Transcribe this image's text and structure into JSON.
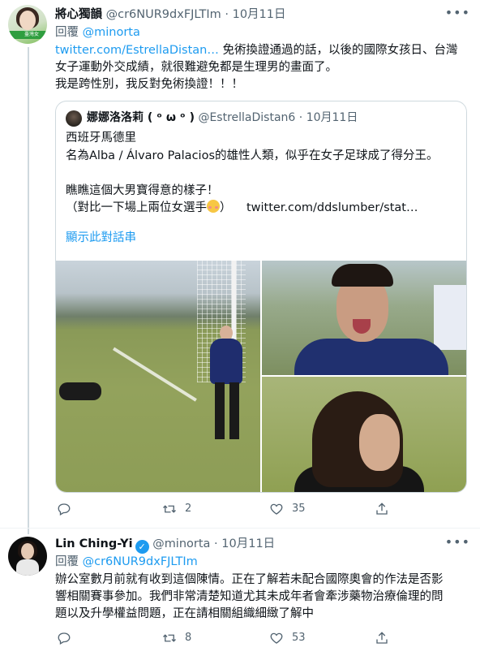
{
  "tweet1": {
    "display_name": "將心獨韻",
    "handle": "@cr6NUR9dxFJLTIm",
    "separator": "·",
    "date": "10月11日",
    "avatar_badge": "臺灣女",
    "reply_prefix": "回覆",
    "reply_mention": "@minorta",
    "body_link": "twitter.com/EstrellaDistan…",
    "body_line1_rest": " 免術換證通過的話，以後的國際女孩日、台灣",
    "body_line2": "女子運動外交成績，就很難避免都是生理男的畫面了。",
    "body_line3": "我是跨性別，我反對免術換證！！！",
    "quote": {
      "display_name": "娜娜洛洛莉 ( ᵒ ω ᵒ )",
      "handle": "@EstrellaDistan6",
      "separator": "·",
      "date": "10月11日",
      "lines": [
        "西班牙馬德里",
        "名為Alba / Álvaro Palacios的雄性人類，似乎在女子足球成了得分王。",
        "",
        "瞧瞧這個大男寶得意的樣子！",
        ""
      ],
      "last_line_text": "（對比一下場上兩位女選手",
      "last_line_close": "）",
      "last_line_link": "twitter.com/ddslumber/stat…",
      "show_thread": "顯示此對話串"
    },
    "actions": {
      "replies": "",
      "retweets": "2",
      "likes": "35"
    }
  },
  "tweet2": {
    "display_name": "Lin Ching-Yi",
    "handle": "@minorta",
    "separator": "·",
    "date": "10月11日",
    "reply_prefix": "回覆",
    "reply_mention": "@cr6NUR9dxFJLTIm",
    "body_lines": [
      "辦公室數月前就有收到這個陳情。正在了解若未配合國際奧會的作法是否影",
      "響相關賽事參加。我們非常清楚知道尤其未成年者會牽涉藥物治療倫理的問",
      "題以及升學權益問題，正在請相關組織細緻了解中"
    ],
    "actions": {
      "replies": "",
      "retweets": "8",
      "likes": "53"
    }
  },
  "icons": {
    "more": "more-dots-icon",
    "reply": "reply-bubble-icon",
    "retweet": "retweet-icon",
    "like": "heart-icon",
    "share": "share-upload-icon",
    "verified": "verified-badge-icon"
  },
  "colors": {
    "accent": "#1d9bf0",
    "text_primary": "#0f1419",
    "text_secondary": "#536471",
    "border": "#cfd9de"
  }
}
